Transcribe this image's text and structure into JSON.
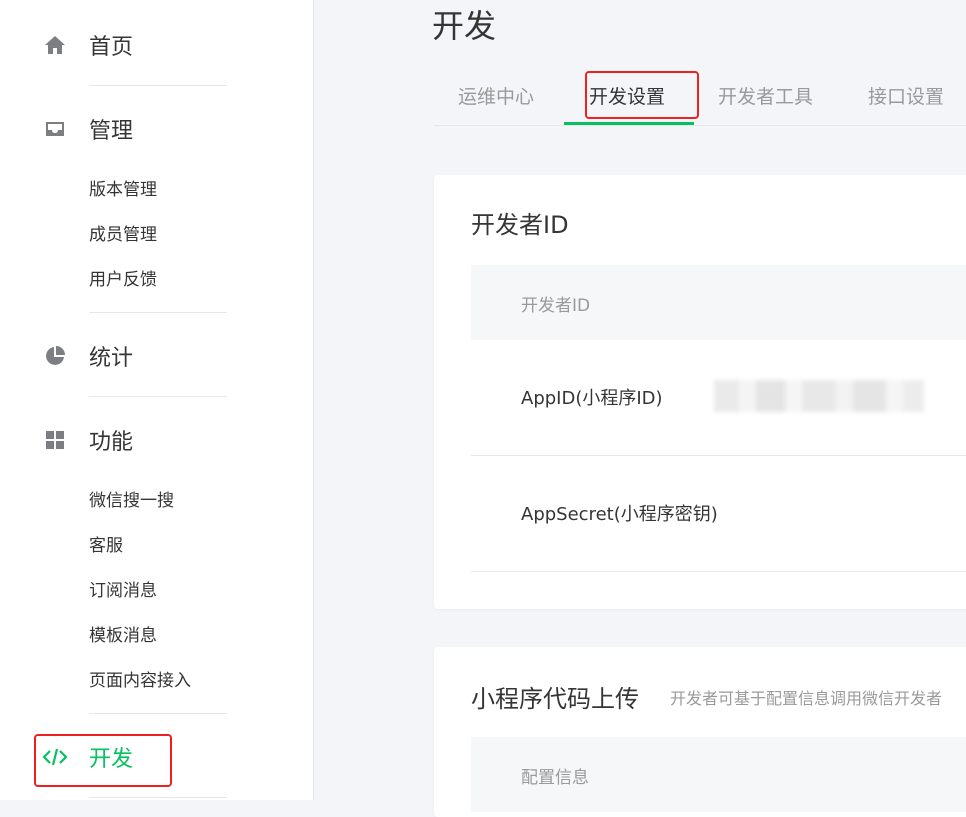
{
  "sidebar": {
    "sections": [
      {
        "label": "首页",
        "icon": "home-icon"
      },
      {
        "label": "管理",
        "icon": "inbox-icon",
        "items": [
          "版本管理",
          "成员管理",
          "用户反馈"
        ]
      },
      {
        "label": "统计",
        "icon": "pie-chart-icon"
      },
      {
        "label": "功能",
        "icon": "grid-icon",
        "items": [
          "微信搜一搜",
          "客服",
          "订阅消息",
          "模板消息",
          "页面内容接入"
        ]
      },
      {
        "label": "开发",
        "icon": "code-icon",
        "active": true
      }
    ]
  },
  "page": {
    "title": "开发",
    "tabs": [
      "运维中心",
      "开发设置",
      "开发者工具",
      "接口设置"
    ],
    "active_tab": "开发设置"
  },
  "developer_id_card": {
    "title": "开发者ID",
    "header": "开发者ID",
    "rows": [
      {
        "key": "AppID(小程序ID)"
      },
      {
        "key": "AppSecret(小程序密钥)"
      }
    ]
  },
  "upload_card": {
    "title": "小程序代码上传",
    "description": "开发者可基于配置信息调用微信开发者",
    "header": "配置信息"
  },
  "colors": {
    "accent": "#07c160",
    "annotation": "#f02020"
  }
}
